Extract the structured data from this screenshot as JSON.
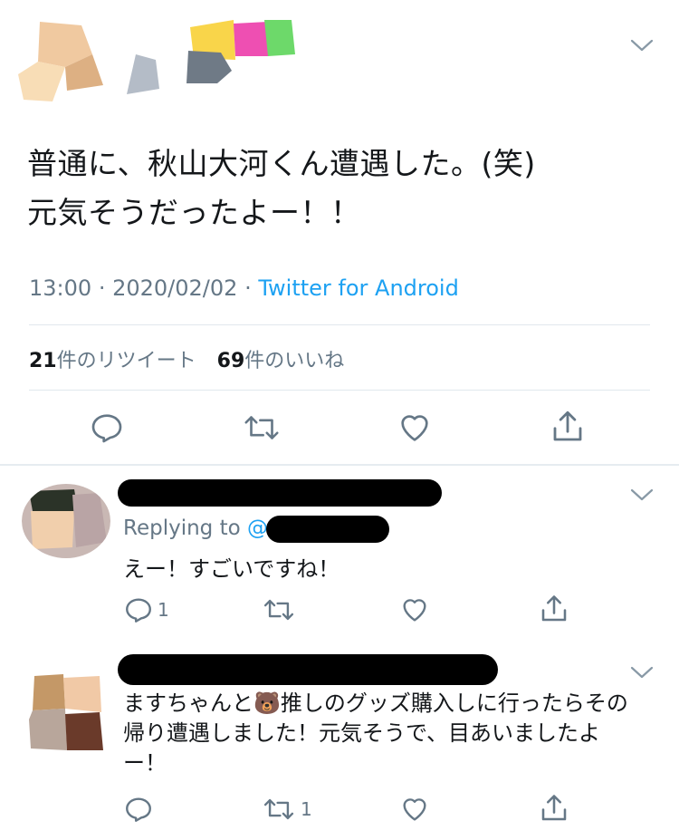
{
  "main_tweet": {
    "text_line1": "普通に、秋山大河くん遭遇した。(笑)",
    "text_line2": "元気そうだったよー！！",
    "time": "13:00",
    "date": "2020/02/02",
    "sep1": "·",
    "sep2": "·",
    "source": "Twitter for Android",
    "retweet_count": "21",
    "retweet_label": "件のリツイート",
    "like_count": "69",
    "like_label": "件のいいね"
  },
  "replies": [
    {
      "replying_prefix": "Replying to ",
      "at_sign": "@",
      "text": "えー！すごいですね！",
      "reply_count": "1",
      "retweet_count": "",
      "like_count": ""
    },
    {
      "text_line1_pre": "ますちゃんと",
      "emoji": "🐻",
      "text_line1_post": "推しのグッズ購入しに行ったらその",
      "text_line2": "帰り遭遇しました！元気そうで、目あいましたよ",
      "text_line3": "ー！",
      "reply_count": "",
      "retweet_count": "1",
      "like_count": ""
    }
  ],
  "icons": {
    "reply": "reply-icon",
    "retweet": "retweet-icon",
    "like": "heart-icon",
    "share": "share-icon",
    "more": "chevron-down-icon"
  },
  "colors": {
    "link": "#1da1f2",
    "muted": "#657786",
    "text": "#14171a",
    "divider": "#e1e8ed"
  }
}
